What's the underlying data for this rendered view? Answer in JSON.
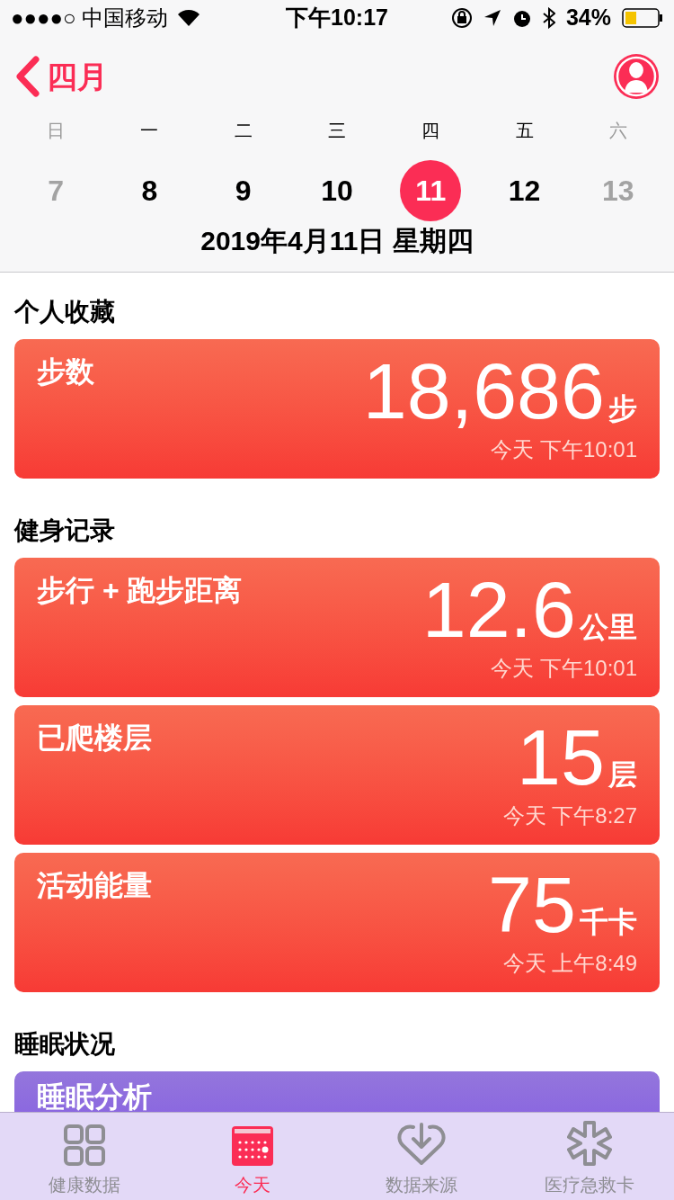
{
  "status_bar": {
    "carrier": "●●●●○ 中国移动",
    "time": "下午10:17",
    "battery": "34%"
  },
  "nav": {
    "back": "四月"
  },
  "week": [
    {
      "weekday": "日",
      "date": "7",
      "selected": false,
      "dimmed": true
    },
    {
      "weekday": "一",
      "date": "8",
      "selected": false,
      "dimmed": false
    },
    {
      "weekday": "二",
      "date": "9",
      "selected": false,
      "dimmed": false
    },
    {
      "weekday": "三",
      "date": "10",
      "selected": false,
      "dimmed": false
    },
    {
      "weekday": "四",
      "date": "11",
      "selected": true,
      "dimmed": false
    },
    {
      "weekday": "五",
      "date": "12",
      "selected": false,
      "dimmed": false
    },
    {
      "weekday": "六",
      "date": "13",
      "selected": false,
      "dimmed": true
    }
  ],
  "full_date": "2019年4月11日 星期四",
  "sections": [
    {
      "title": "个人收藏",
      "cards": [
        {
          "kind": "activity",
          "title": "步数",
          "values": [
            {
              "number": "18,686",
              "unit": "步"
            }
          ],
          "time": "今天 下午10:01"
        }
      ]
    },
    {
      "title": "健身记录",
      "cards": [
        {
          "kind": "activity",
          "title": "步行 + 跑步距离",
          "values": [
            {
              "number": "12.6",
              "unit": "公里"
            }
          ],
          "time": "今天 下午10:01"
        },
        {
          "kind": "activity",
          "title": "已爬楼层",
          "values": [
            {
              "number": "15",
              "unit": "层"
            }
          ],
          "time": "今天 下午8:27"
        },
        {
          "kind": "activity",
          "title": "活动能量",
          "values": [
            {
              "number": "75",
              "unit": "千卡"
            }
          ],
          "time": "今天 上午8:49"
        }
      ]
    },
    {
      "title": "睡眠状况",
      "cards": [
        {
          "kind": "sleep",
          "title": "睡眠分析"
        }
      ]
    }
  ],
  "tab_bar": [
    {
      "kind": "grid",
      "label": "健康数据",
      "selected": false
    },
    {
      "kind": "calendar",
      "label": "今天",
      "selected": true
    },
    {
      "kind": "sources",
      "label": "数据来源",
      "selected": false
    },
    {
      "kind": "medical",
      "label": "医疗急救卡",
      "selected": false
    }
  ]
}
